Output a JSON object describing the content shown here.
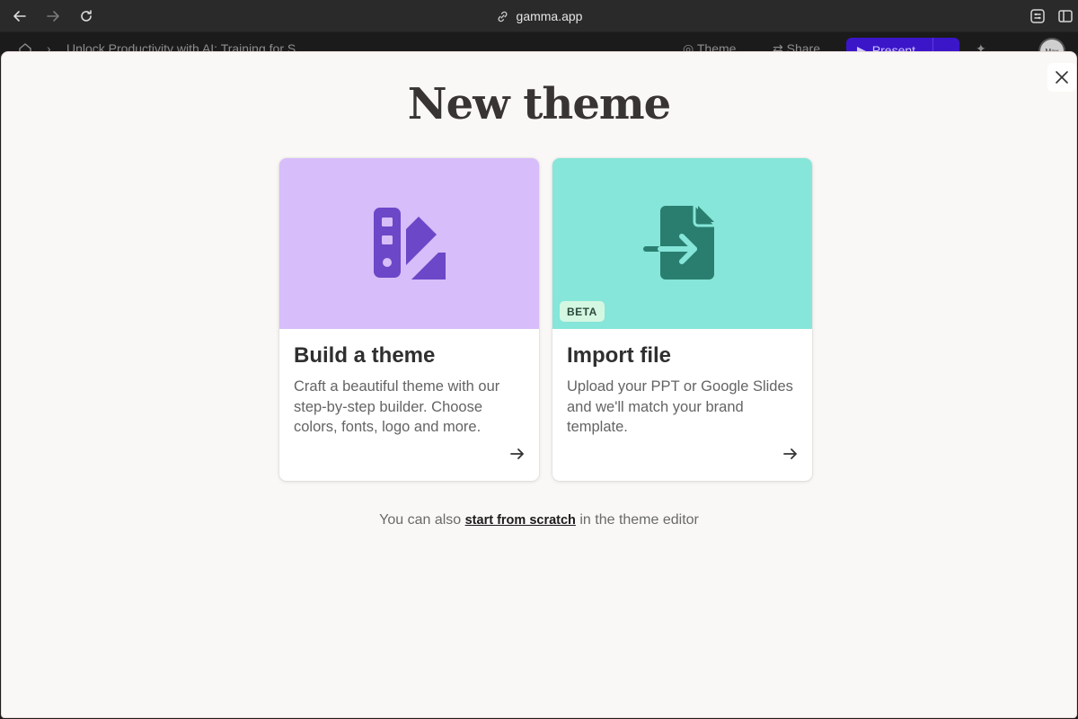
{
  "browser": {
    "url": "gamma.app",
    "icons": {
      "back": "arrow-left-icon",
      "forward": "arrow-right-icon",
      "reload": "reload-icon",
      "link": "link-icon",
      "extension": "extension-icon"
    }
  },
  "app_header": {
    "doc_title": "Unlock Productivity with AI: Training for S",
    "theme_label": "Theme",
    "share_label": "Share",
    "present_label": "Present",
    "more_label": "...",
    "avatar_text": "Max"
  },
  "modal": {
    "title": "New theme",
    "cards": [
      {
        "title": "Build a theme",
        "description": "Craft a beautiful theme with our step-by-step builder. Choose colors, fonts, logo and more.",
        "hero_color": "#d7bdf9",
        "icon": "swatch-palette-icon",
        "icon_color": "#6c47c8"
      },
      {
        "title": "Import file",
        "description": "Upload your PPT or Google Slides and we'll match your brand template.",
        "hero_color": "#85e6d9",
        "icon": "import-file-icon",
        "icon_color": "#2a7e70",
        "badge": "BETA"
      }
    ],
    "footer": {
      "prefix": "You can also ",
      "link": "start from scratch",
      "suffix": " in the theme editor"
    }
  }
}
